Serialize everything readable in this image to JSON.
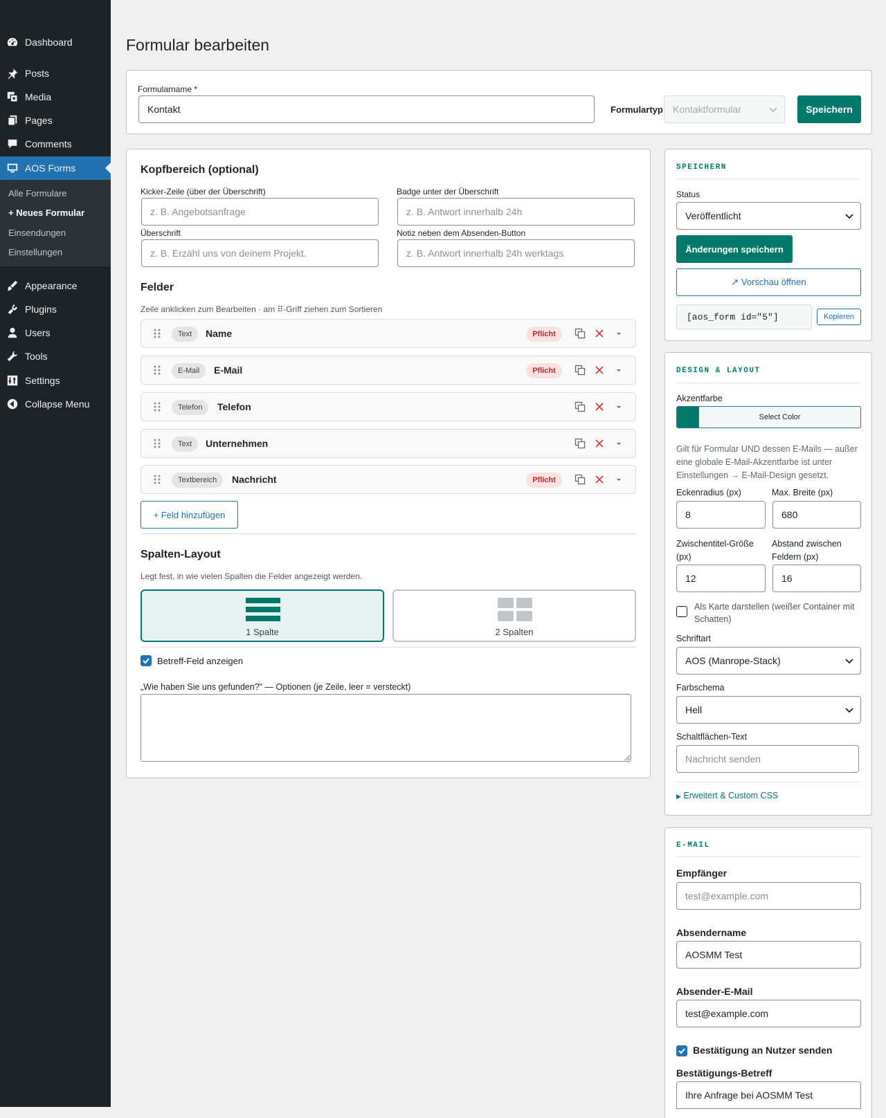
{
  "sidebar": {
    "items": [
      {
        "label": "Dashboard",
        "icon": "dashboard-icon"
      },
      {
        "label": "Posts",
        "icon": "pin-icon"
      },
      {
        "label": "Media",
        "icon": "media-icon"
      },
      {
        "label": "Pages",
        "icon": "pages-icon"
      },
      {
        "label": "Comments",
        "icon": "comment-icon"
      },
      {
        "label": "AOS Forms",
        "icon": "monitor-icon",
        "active": true
      },
      {
        "label": "Appearance",
        "icon": "brush-icon"
      },
      {
        "label": "Plugins",
        "icon": "plugin-icon"
      },
      {
        "label": "Users",
        "icon": "user-icon"
      },
      {
        "label": "Tools",
        "icon": "wrench-icon"
      },
      {
        "label": "Settings",
        "icon": "settings-icon"
      },
      {
        "label": "Collapse Menu",
        "icon": "collapse-icon"
      }
    ],
    "submenu": [
      {
        "label": "Alle Formulare"
      },
      {
        "label": "+ Neues Formular",
        "current": true
      },
      {
        "label": "Einsendungen"
      },
      {
        "label": "Einstellungen"
      }
    ]
  },
  "page": {
    "title": "Formular bearbeiten"
  },
  "topbar": {
    "name_label": "Formularname *",
    "name_value": "Kontakt",
    "type_label": "Formulartyp",
    "type_value": "Kontaktformular",
    "save_label": "Speichern"
  },
  "header_section": {
    "title": "Kopfbereich (optional)",
    "kicker_label": "Kicker-Zeile (über der Überschrift)",
    "kicker_placeholder": "z. B. Angebotsanfrage",
    "badge_label": "Badge unter der Überschrift",
    "badge_placeholder": "z. B. Antwort innerhalb 24h",
    "heading_label": "Überschrift",
    "heading_placeholder": "z. B. Erzähl uns von deinem Projekt.",
    "note_label": "Notiz neben dem Absenden-Button",
    "note_placeholder": "z. B. Antwort innerhalb 24h werktags"
  },
  "fields": {
    "title": "Felder",
    "help": "Zeile anklicken zum Bearbeiten · am ⠿-Griff ziehen zum Sortieren",
    "rows": [
      {
        "type": "Text",
        "name": "Name",
        "required": "Pflicht"
      },
      {
        "type": "E-Mail",
        "name": "E-Mail",
        "required": "Pflicht"
      },
      {
        "type": "Telefon",
        "name": "Telefon",
        "required": ""
      },
      {
        "type": "Text",
        "name": "Unternehmen",
        "required": ""
      },
      {
        "type": "Textbereich",
        "name": "Nachricht",
        "required": "Pflicht"
      }
    ],
    "add_label": "+ Feld hinzufügen"
  },
  "columns": {
    "title": "Spalten-Layout",
    "help": "Legt fest, in wie vielen Spalten die Felder angezeigt werden.",
    "option1": "1 Spalte",
    "option2": "2 Spalten",
    "selected": "1 Spalte"
  },
  "subject": {
    "label": "Betreff-Feld anzeigen",
    "checked": true
  },
  "found": {
    "label": "„Wie haben Sie uns gefunden?\" — Optionen (je Zeile, leer = versteckt)",
    "value": ""
  },
  "save_box": {
    "title": "SPEICHERN",
    "status_label": "Status",
    "status_value": "Veröffentlicht",
    "save_changes": "Änderungen speichern",
    "preview": "↗ Vorschau öffnen",
    "shortcode": "[aos_form id=\"5\"]",
    "copy": "Kopieren"
  },
  "design": {
    "title": "DESIGN & LAYOUT",
    "accent_label": "Akzentfarbe",
    "accent_color": "#00796b",
    "select_color": "Select Color",
    "accent_help": "Gilt für Formular UND dessen E-Mails — außer eine globale E-Mail-Akzentfarbe ist unter Einstellungen → E-Mail-Design gesetzt.",
    "radius_label": "Eckenradius (px)",
    "radius_value": "8",
    "maxwidth_label": "Max. Breite (px)",
    "maxwidth_value": "680",
    "subtitle_label": "Zwischentitel-Größe (px)",
    "subtitle_value": "12",
    "gap_label": "Abstand zwischen Feldern (px)",
    "gap_value": "16",
    "card_label": "Als Karte darstellen (weißer Container mit Schatten)",
    "card_checked": false,
    "font_label": "Schriftart",
    "font_value": "AOS (Manrope-Stack)",
    "scheme_label": "Farbschema",
    "scheme_value": "Hell",
    "button_text_label": "Schaltflächen-Text",
    "button_text_placeholder": "Nachricht senden",
    "advanced": "Erweitert & Custom CSS"
  },
  "email": {
    "title": "E-MAIL",
    "recipient_label": "Empfänger",
    "recipient_placeholder": "test@example.com",
    "sender_name_label": "Absendername",
    "sender_name_value": "AOSMM Test",
    "sender_email_label": "Absender-E-Mail",
    "sender_email_value": "test@example.com",
    "confirm_label": "Bestätigung an Nutzer senden",
    "confirm_checked": true,
    "confirm_subject_label": "Bestätigungs-Betreff",
    "confirm_subject_value": "Ihre Anfrage bei AOSMM Test"
  },
  "colors": {
    "accent": "#00796b",
    "wp_blue": "#2271b1",
    "sidebar": "#1d2327",
    "danger": "#b32d2e"
  }
}
